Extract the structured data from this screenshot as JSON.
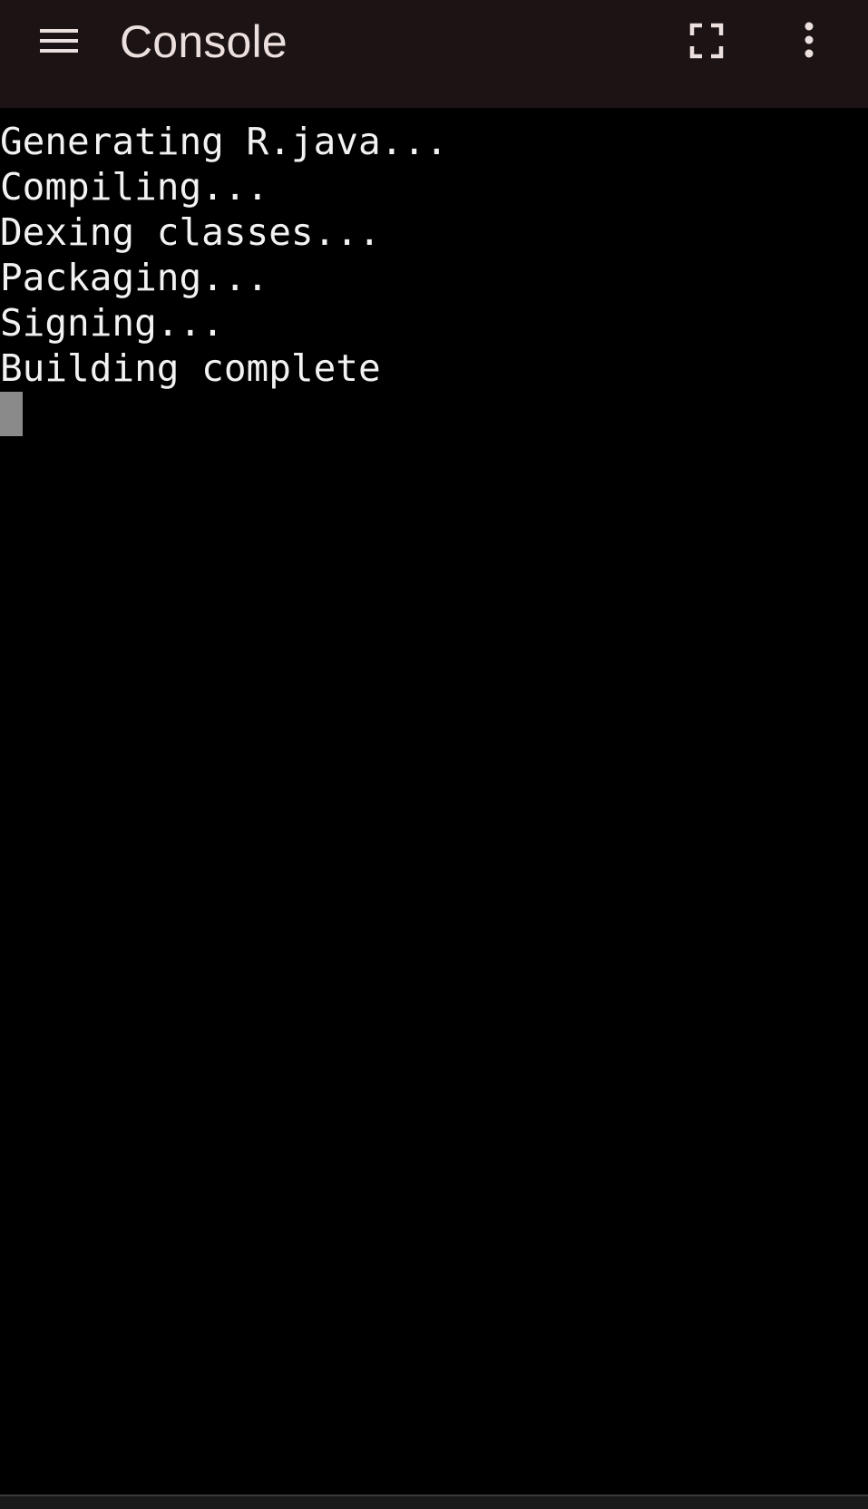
{
  "app_bar": {
    "title": "Console",
    "icons": {
      "menu": "menu-icon",
      "fullscreen": "fullscreen-icon",
      "more": "more-vert-icon"
    }
  },
  "console": {
    "lines": [
      "Generating R.java...",
      "Compiling...",
      "Dexing classes...",
      "Packaging...",
      "Signing...",
      "Building complete"
    ]
  },
  "colors": {
    "app_bar_background": "#1c1314",
    "console_background": "#000000",
    "console_text": "#f2f2f2",
    "cursor": "#8a8a8a",
    "icon": "#ece0df"
  }
}
